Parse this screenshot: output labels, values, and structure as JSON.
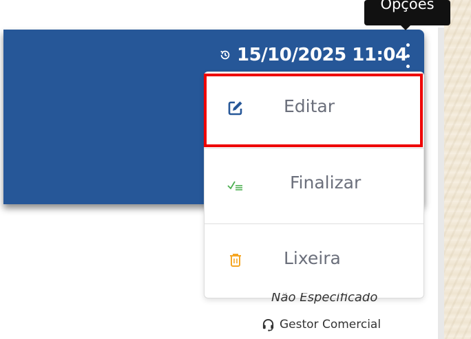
{
  "tooltip": {
    "label": "Opções"
  },
  "header": {
    "datetime": "15/10/2025 11:04",
    "clock_icon": "history-clock-icon",
    "options_icon": "kebab-menu-icon",
    "background_color": "#265798"
  },
  "menu": {
    "items": [
      {
        "label": "Editar",
        "icon": "edit-pencil-icon",
        "icon_color": "#265798"
      },
      {
        "label": "Finalizar",
        "icon": "check-list-icon",
        "icon_color": "#4caf50"
      },
      {
        "label": "Lixeira",
        "icon": "trash-icon",
        "icon_color": "#f5a623"
      }
    ],
    "highlight_color": "#ee0000"
  },
  "footer": {
    "specified_text": "Não Especificado",
    "role_icon": "headset-icon",
    "role_text": "Gestor Comercial"
  }
}
